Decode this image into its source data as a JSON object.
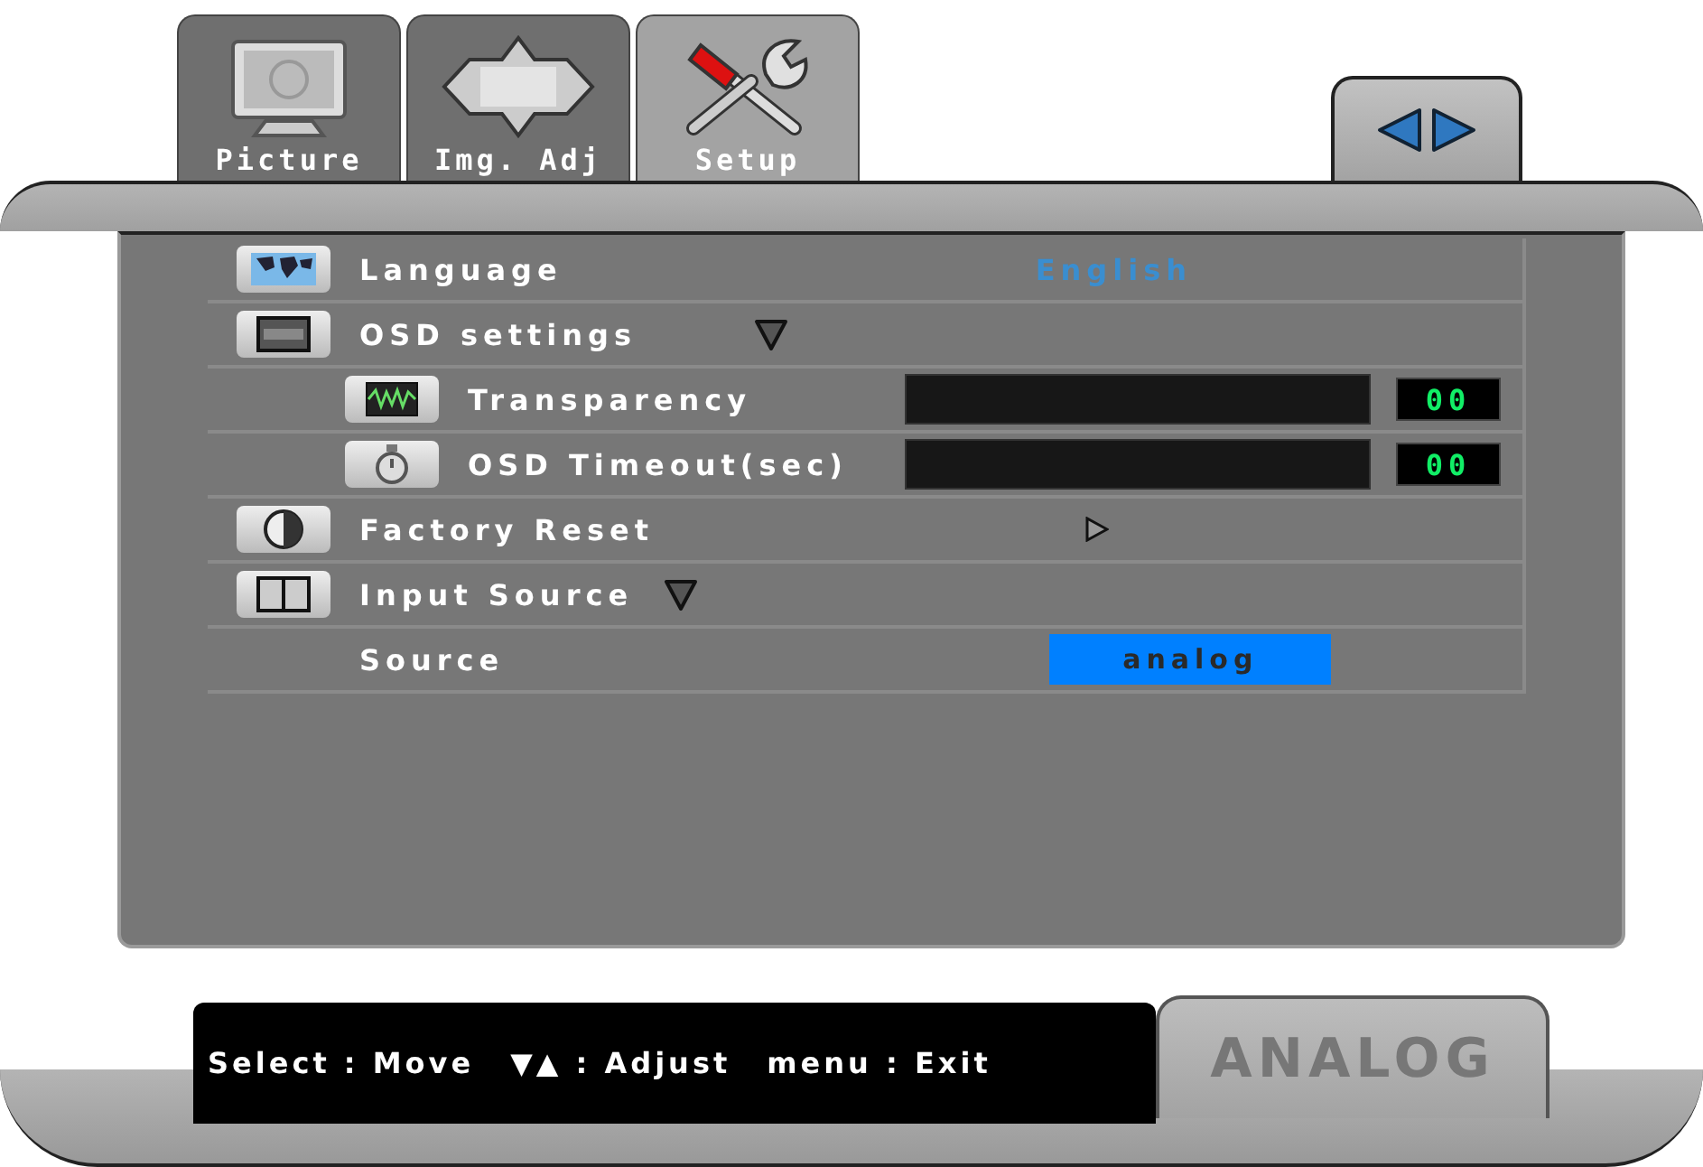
{
  "tabs": [
    {
      "label": "Picture",
      "selected": false
    },
    {
      "label": "Img. Adj",
      "selected": false
    },
    {
      "label": "Setup",
      "selected": true
    }
  ],
  "menu": [
    {
      "label": "Language",
      "kind": "option",
      "value": "English"
    },
    {
      "label": "OSD settings",
      "kind": "group",
      "expanded": true,
      "children": [
        {
          "label": "Transparency",
          "kind": "slider",
          "level": 0,
          "reading": "00"
        },
        {
          "label": "OSD Timeout(sec)",
          "kind": "slider",
          "level": 0,
          "reading": "00"
        }
      ]
    },
    {
      "label": "Factory Reset",
      "kind": "action"
    },
    {
      "label": "Input Source",
      "kind": "group",
      "expanded": true,
      "children": [
        {
          "label": "Source",
          "kind": "select",
          "value": "analog"
        }
      ]
    }
  ],
  "help": [
    "Select : Move",
    "▼▲ : Adjust",
    "menu : Exit"
  ],
  "mode": "ANALOG"
}
